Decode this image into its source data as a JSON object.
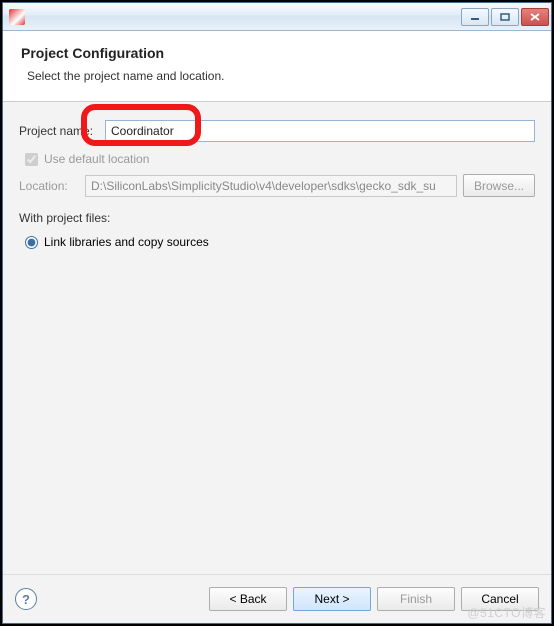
{
  "titlebar": {
    "title": ""
  },
  "header": {
    "title": "Project Configuration",
    "subtitle": "Select the project name and location."
  },
  "form": {
    "project_name_label": "Project name:",
    "project_name_value": "Coordinator",
    "use_default_label": "Use default location",
    "use_default_checked": true,
    "location_label": "Location:",
    "location_value": "D:\\SiliconLabs\\SimplicityStudio\\v4\\developer\\sdks\\gecko_sdk_su",
    "browse_label": "Browse...",
    "project_files_label": "With project files:",
    "radio_link_label": "Link libraries and copy sources",
    "radio_link_selected": true
  },
  "footer": {
    "back": "< Back",
    "next": "Next >",
    "finish": "Finish",
    "cancel": "Cancel"
  },
  "watermark": "@51CTO博客"
}
